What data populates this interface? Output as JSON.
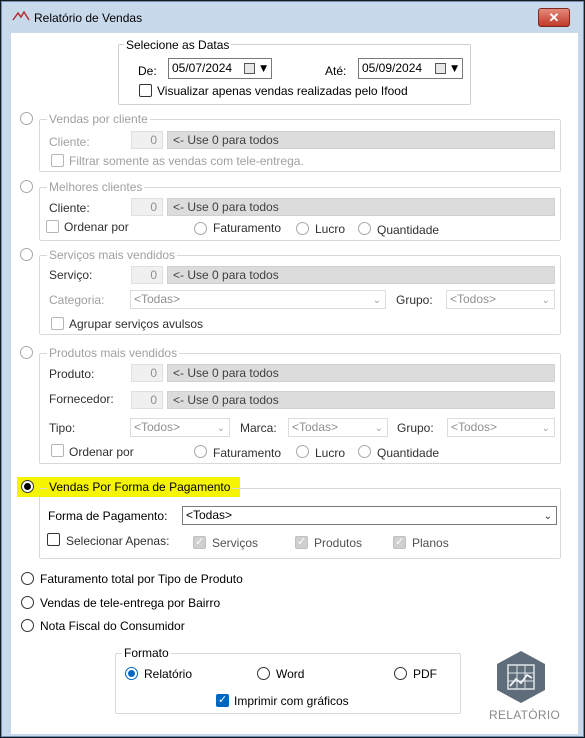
{
  "window": {
    "title": "Relatório de Vendas",
    "close_glyph": "✕"
  },
  "dates": {
    "legend": "Selecione as Datas",
    "from_label": "De:",
    "from_value": "05/07/2024",
    "to_label": "Até:",
    "to_value": "05/09/2024",
    "ifood_label": "Visualizar apenas vendas realizadas pelo Ifood"
  },
  "vendas_cliente": {
    "legend": "Vendas por cliente",
    "cliente_label": "Cliente:",
    "cliente_value": "0",
    "cliente_hint": "<- Use 0 para todos",
    "tele_label": "Filtrar somente as vendas com tele-entrega."
  },
  "melhores_clientes": {
    "legend": "Melhores clientes",
    "cliente_label": "Cliente:",
    "cliente_value": "0",
    "cliente_hint": "<- Use 0 para todos",
    "ordenar_label": "Ordenar por",
    "opt_faturamento": "Faturamento",
    "opt_lucro": "Lucro",
    "opt_quantidade": "Quantidade"
  },
  "servicos": {
    "legend": "Serviços mais vendidos",
    "servico_label": "Serviço:",
    "servico_value": "0",
    "servico_hint": "<- Use 0 para todos",
    "categoria_label": "Categoria:",
    "categoria_value": "<Todas>",
    "grupo_label": "Grupo:",
    "grupo_value": "<Todos>",
    "agrupar_label": "Agrupar serviços avulsos"
  },
  "produtos": {
    "legend": "Produtos mais vendidos",
    "produto_label": "Produto:",
    "produto_value": "0",
    "produto_hint": "<- Use 0 para todos",
    "fornecedor_label": "Fornecedor:",
    "fornecedor_value": "0",
    "fornecedor_hint": "<- Use 0 para todos",
    "tipo_label": "Tipo:",
    "tipo_value": "<Todos>",
    "marca_label": "Marca:",
    "marca_value": "<Todas>",
    "grupo_label": "Grupo:",
    "grupo_value": "<Todos>",
    "ordenar_label": "Ordenar por",
    "opt_faturamento": "Faturamento",
    "opt_lucro": "Lucro",
    "opt_quantidade": "Quantidade"
  },
  "pagamento": {
    "legend": "Vendas Por Forma de Pagamento",
    "forma_label": "Forma de Pagamento:",
    "forma_value": "<Todas>",
    "selecionar_label": "Selecionar Apenas:",
    "opt_servicos": "Serviços",
    "opt_produtos": "Produtos",
    "opt_planos": "Planos"
  },
  "other_reports": {
    "tipo_produto": "Faturamento total por Tipo de Produto",
    "tele_bairro": "Vendas de tele-entrega por Bairro",
    "nota_fiscal": "Nota Fiscal do Consumidor"
  },
  "formato": {
    "legend": "Formato",
    "opt_relatorio": "Relatório",
    "opt_word": "Word",
    "opt_pdf": "PDF",
    "graficos_label": "Imprimir com gráficos"
  },
  "action": {
    "button_label": "RELATÓRIO",
    "icon": "report-chart-icon"
  },
  "colors": {
    "highlight": "#f5f500",
    "accent": "#0067c0",
    "titlebar": "#c9d9ec",
    "close": "#c0392b"
  }
}
